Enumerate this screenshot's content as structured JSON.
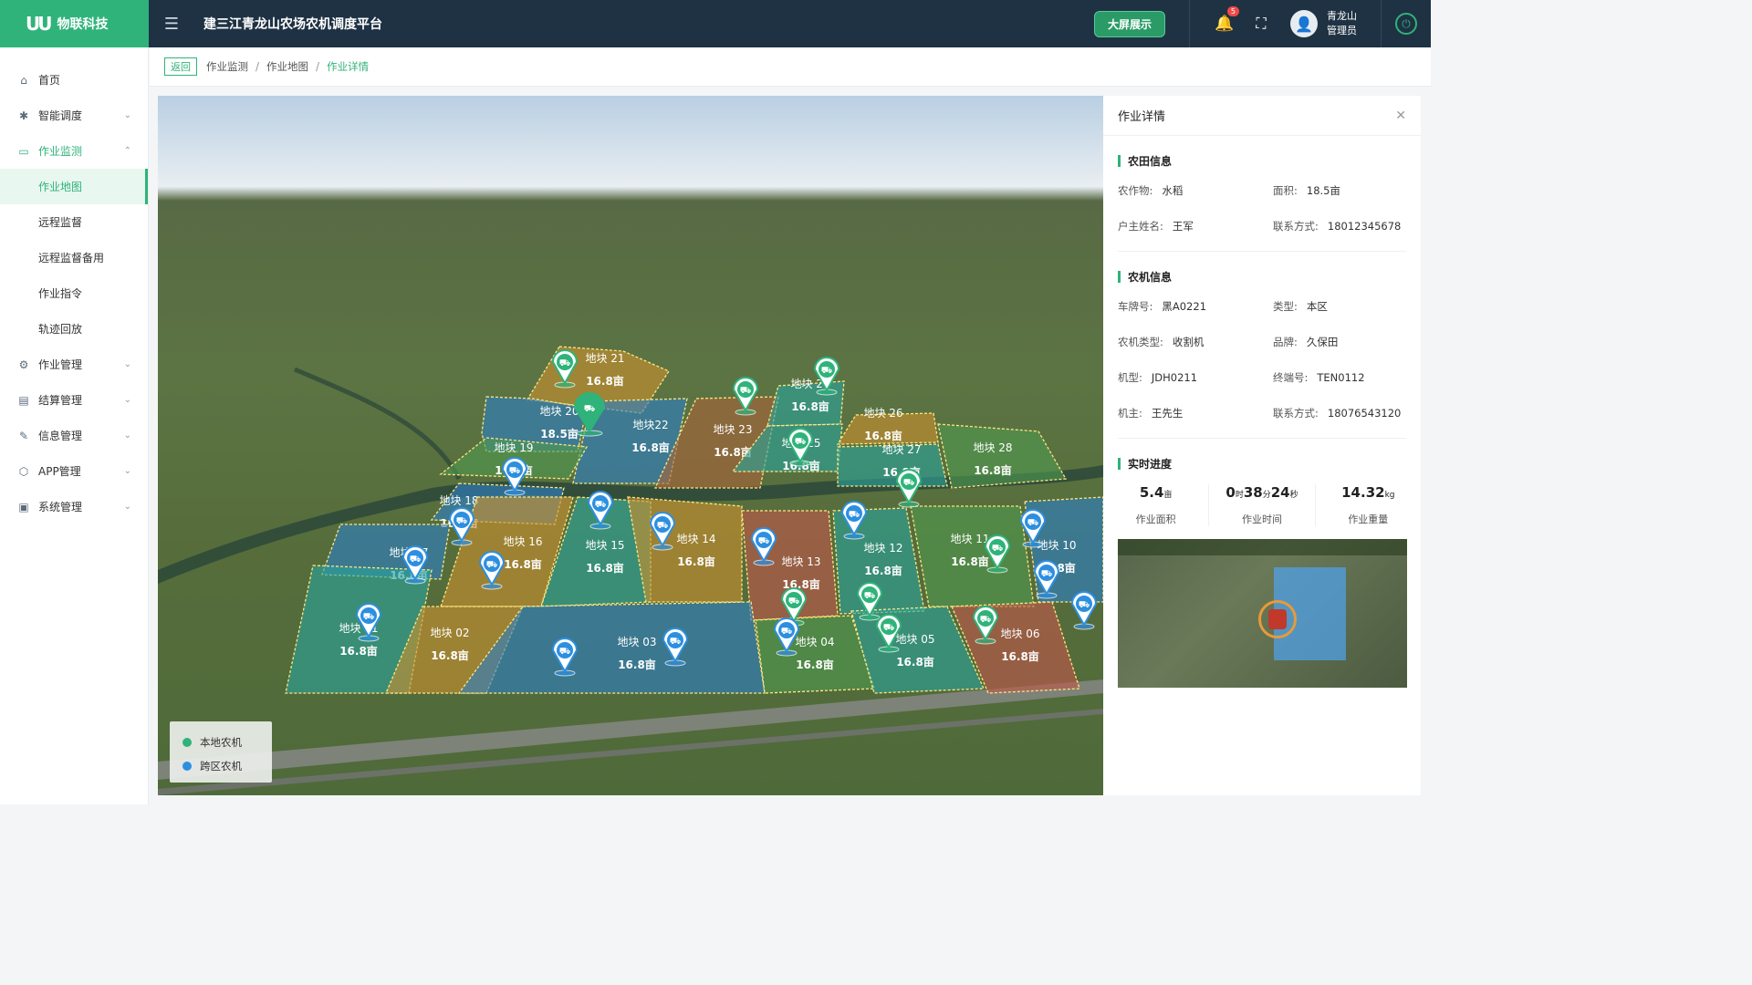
{
  "app": {
    "logo_text": "物联科技",
    "logo_mark": "UU",
    "title": "建三江青龙山农场农机调度平台",
    "big_screen_label": "大屏展示",
    "notification_count": "5",
    "user_name": "青龙山",
    "user_role": "管理员"
  },
  "sidebar": {
    "items": [
      {
        "label": "首页",
        "icon": "home-icon"
      },
      {
        "label": "智能调度",
        "icon": "dispatch-icon"
      },
      {
        "label": "作业监测",
        "icon": "monitor-icon"
      },
      {
        "label": "作业地图"
      },
      {
        "label": "远程监督"
      },
      {
        "label": "远程监督备用"
      },
      {
        "label": "作业指令"
      },
      {
        "label": "轨迹回放"
      },
      {
        "label": "作业管理",
        "icon": "gear-icon"
      },
      {
        "label": "结算管理",
        "icon": "settlement-icon"
      },
      {
        "label": "信息管理",
        "icon": "info-icon"
      },
      {
        "label": "APP管理",
        "icon": "app-icon"
      },
      {
        "label": "系统管理",
        "icon": "system-icon"
      }
    ]
  },
  "breadcrumb": {
    "back_label": "返回",
    "items": [
      "作业监测",
      "作业地图",
      "作业详情"
    ]
  },
  "map": {
    "plots": [
      {
        "name": "地块 21",
        "area": "16.8亩"
      },
      {
        "name": "地块 20",
        "area": "18.5亩"
      },
      {
        "name": "地块22",
        "area": "16.8亩"
      },
      {
        "name": "地块 23",
        "area": "16.8亩"
      },
      {
        "name": "地块 24",
        "area": "16.8亩"
      },
      {
        "name": "地块 25",
        "area": "16.8亩"
      },
      {
        "name": "地块 26",
        "area": "16.8亩"
      },
      {
        "name": "地块 27",
        "area": "16.8亩"
      },
      {
        "name": "地块 28",
        "area": "16.8亩"
      },
      {
        "name": "地块 19",
        "area": "16.8亩"
      },
      {
        "name": "地块 18",
        "area": "16.8亩"
      },
      {
        "name": "地块 17",
        "area": "16.8亩"
      },
      {
        "name": "地块 16",
        "area": "16.8亩"
      },
      {
        "name": "地块 15",
        "area": "16.8亩"
      },
      {
        "name": "地块 14",
        "area": "16.8亩"
      },
      {
        "name": "地块 13",
        "area": "16.8亩"
      },
      {
        "name": "地块 12",
        "area": "16.8亩"
      },
      {
        "name": "地块 11",
        "area": "16.8亩"
      },
      {
        "name": "地块 10",
        "area": "16.8亩"
      },
      {
        "name": "地块 01",
        "area": "16.8亩"
      },
      {
        "name": "地块 02",
        "area": "16.8亩"
      },
      {
        "name": "地块 03",
        "area": "16.8亩"
      },
      {
        "name": "地块 04",
        "area": "16.8亩"
      },
      {
        "name": "地块 05",
        "area": "16.8亩"
      },
      {
        "name": "地块 06",
        "area": "16.8亩"
      }
    ],
    "legend": [
      {
        "label": "本地农机",
        "color": "#2fb37a"
      },
      {
        "label": "跨区农机",
        "color": "#2d8fe0"
      }
    ]
  },
  "detail": {
    "title": "作业详情",
    "field_section": "农田信息",
    "field": [
      {
        "k": "农作物:",
        "v": "水稻"
      },
      {
        "k": "面积:",
        "v": "18.5亩"
      },
      {
        "k": "户主姓名:",
        "v": "王军"
      },
      {
        "k": "联系方式:",
        "v": "18012345678"
      }
    ],
    "machine_section": "农机信息",
    "machine": [
      {
        "k": "车牌号:",
        "v": "黑A0221"
      },
      {
        "k": "类型:",
        "v": "本区"
      },
      {
        "k": "农机类型:",
        "v": "收割机"
      },
      {
        "k": "品牌:",
        "v": "久保田"
      },
      {
        "k": "机型:",
        "v": "JDH0211"
      },
      {
        "k": "终端号:",
        "v": "TEN0112"
      },
      {
        "k": "机主:",
        "v": "王先生"
      },
      {
        "k": "联系方式:",
        "v": "18076543120"
      }
    ],
    "progress_section": "实时进度",
    "stats": {
      "area_value": "5.4",
      "area_unit": "亩",
      "area_label": "作业面积",
      "time_h": "0",
      "time_h_unit": "时",
      "time_m": "38",
      "time_m_unit": "分",
      "time_s": "24",
      "time_s_unit": "秒",
      "time_label": "作业时间",
      "weight_value": "14.32",
      "weight_unit": "kg",
      "weight_label": "作业重量"
    }
  }
}
